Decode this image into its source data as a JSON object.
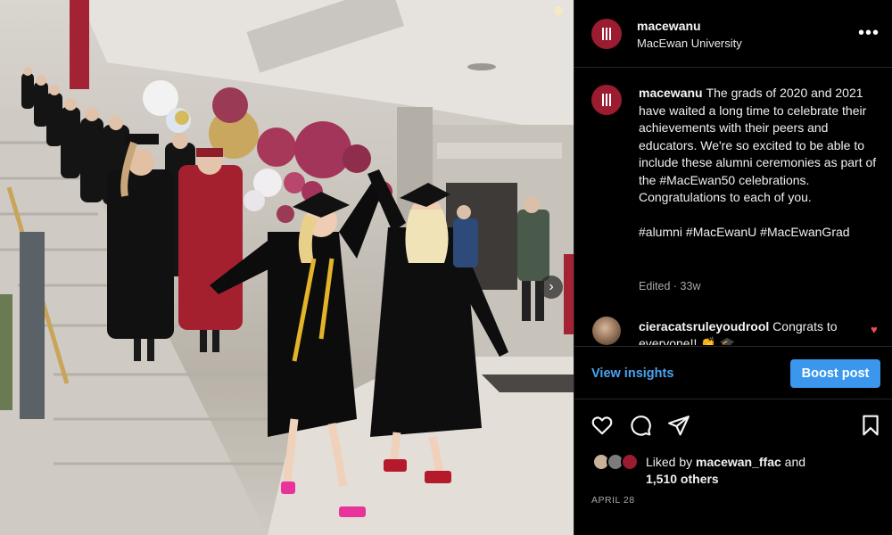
{
  "account": {
    "handle": "macewanu",
    "name": "MacEwan University",
    "brand_color": "#9b1c31",
    "icon": "macewan-logo-icon"
  },
  "photo": {
    "next_icon": "chevron-right-icon",
    "next_glyph": "›"
  },
  "header": {
    "more_glyph": "•••"
  },
  "caption": {
    "handle": "macewanu",
    "text": "The grads of 2020 and 2021 have waited a long time to celebrate their achievements with their peers and educators. We're so excited to be able to include these alumni ceremonies as part of the #MacEwan50 celebrations. Congratulations to each of you.",
    "hashtags": "#alumni #MacEwanU #MacEwanGrad",
    "edited": "Edited · 33w"
  },
  "comment": {
    "handle": "cieracatsruleyoudrool",
    "text": "Congrats to everyone!! 👏 🎓",
    "like_glyph": "♥"
  },
  "insights": {
    "view_label": "View insights",
    "boost_label": "Boost post"
  },
  "actions": {
    "icons": [
      "heart-icon",
      "comment-icon",
      "share-icon",
      "bookmark-icon"
    ]
  },
  "likes": {
    "prefix": "Liked by ",
    "user": "macewan_ffac",
    "middle": " and",
    "others": "1,510 others"
  },
  "date": "APRIL 28",
  "colors": {
    "accent_blue": "#3b97ee",
    "link_blue": "#4aa3f0",
    "heart_red": "#ed4956",
    "gown_maroon": "#9b1c31"
  }
}
